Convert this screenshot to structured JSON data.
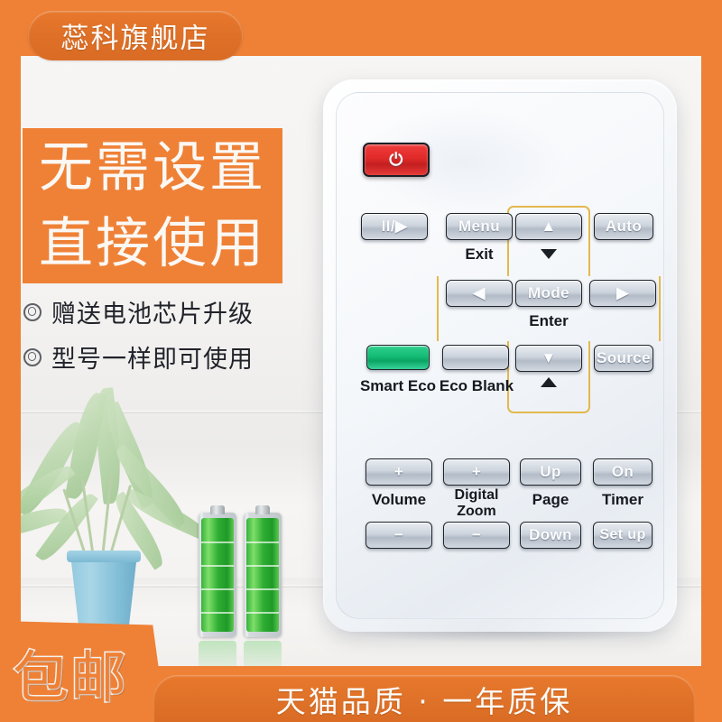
{
  "store_badge": {
    "label": "蕊科旗舰店"
  },
  "headline": {
    "line1": "无需设置",
    "line2": "直接使用"
  },
  "bullets": [
    {
      "icon": "double-circle-icon",
      "text": "赠送电池芯片升级"
    },
    {
      "icon": "double-circle-icon",
      "text": "型号一样即可使用"
    }
  ],
  "remote": {
    "power_button": {
      "glyph": "⏻",
      "name": "power-button"
    },
    "row1": [
      {
        "label": "ΙΙ/▶",
        "name": "freeze-button"
      },
      {
        "label": "Menu",
        "name": "menu-button",
        "sublabel": "Exit"
      },
      {
        "label": "▲",
        "name": "up-arrow-button"
      },
      {
        "label": "Auto",
        "name": "auto-button"
      }
    ],
    "row2": [
      {
        "label": "◀",
        "name": "left-arrow-button"
      },
      {
        "label": "Mode",
        "name": "mode-button",
        "sublabel": "Enter"
      },
      {
        "label": "▶",
        "name": "right-arrow-button"
      }
    ],
    "row3": [
      {
        "label": "",
        "name": "smart-eco-button",
        "sublabel": "Smart Eco"
      },
      {
        "label": "",
        "name": "eco-blank-button",
        "sublabel": "Eco Blank"
      },
      {
        "label": "▼",
        "name": "down-arrow-button"
      },
      {
        "label": "Source",
        "name": "source-button"
      }
    ],
    "bottom_groups": [
      {
        "group": "Volume",
        "top": "+",
        "bottom": "−"
      },
      {
        "group": "Digital Zoom",
        "group_line1": "Digital",
        "group_line2": "Zoom",
        "top": "+",
        "bottom": "−"
      },
      {
        "group": "Page",
        "top": "Up",
        "bottom": "Down"
      },
      {
        "group": "Timer",
        "top": "On",
        "bottom": "Set up"
      }
    ]
  },
  "footer": {
    "shipping": "包邮",
    "quality": "天猫品质 · 一年质保"
  },
  "colors": {
    "orange": "#ef8136",
    "badge_orange": "#de7028",
    "power_red": "#e02a2a",
    "eco_green": "#14bd75",
    "nav_outline": "#e3b84e"
  }
}
